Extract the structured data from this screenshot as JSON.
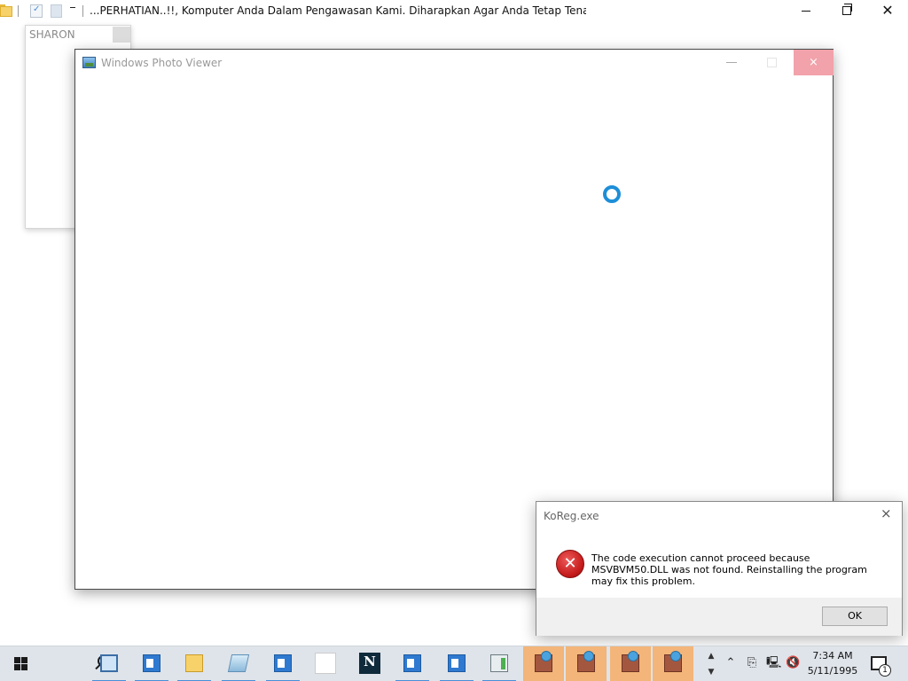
{
  "explorer": {
    "title": "...PERHATIAN..!!, Komputer Anda Dalam Pengawasan Kami. Diharapkan Agar Anda Tetap Tenang D"
  },
  "sharon_window": {
    "title": "SHARON"
  },
  "photo_viewer": {
    "title": "Windows Photo Viewer",
    "close_glyph": "×"
  },
  "error_dialog": {
    "title": "KoReg.exe",
    "close_glyph": "×",
    "icon_glyph": "✕",
    "message": "The code execution cannot proceed because MSVBVM50.DLL was not found. Reinstalling the program may fix this problem.",
    "ok_label": "OK"
  },
  "taskbar": {
    "netscape_glyph": "N",
    "time": "7:34 AM",
    "date": "5/11/1995",
    "notification_count": "1",
    "scroll_up_glyph": "▲",
    "scroll_down_glyph": "▼",
    "tray_glyphs": {
      "chevron": "⌃",
      "meet_now": "⎘",
      "network": "🖳",
      "volume": "🔇"
    },
    "accent_color": "#4a90d8",
    "orange_highlight": "#f3b579"
  },
  "colors": {
    "photo_viewer_close": "#f2a2aa",
    "spinner": "#1e8ed8",
    "error_red": "#c51b1b"
  }
}
